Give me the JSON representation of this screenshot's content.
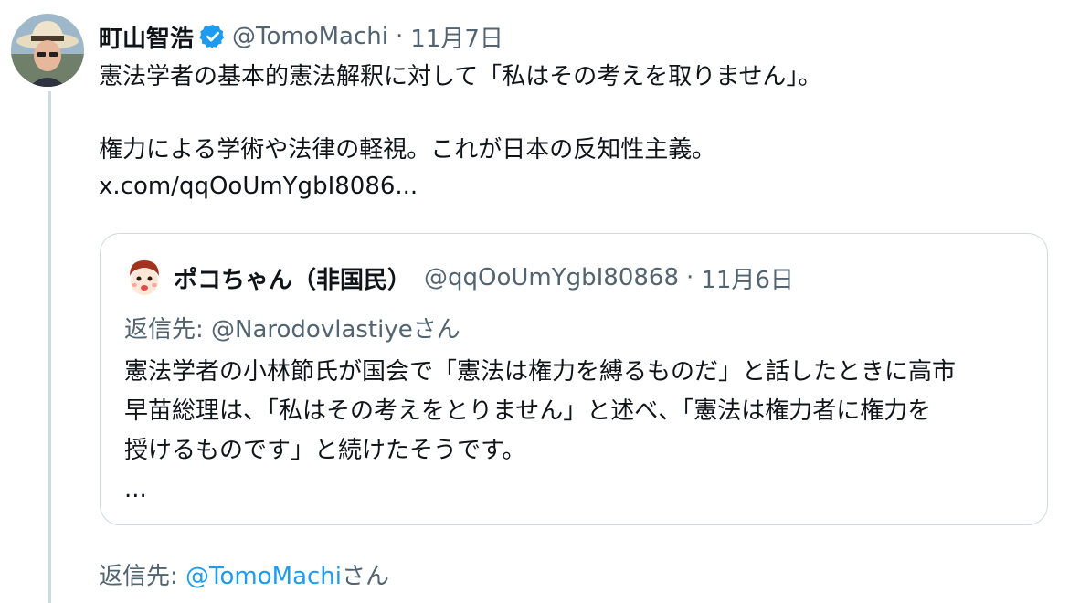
{
  "tweet": {
    "author_name": "町山智浩",
    "author_handle": "@TomoMachi",
    "separator": "·",
    "date": "11月7日",
    "text_line1": "憲法学者の基本的憲法解釈に対して「私はその考えを取りません」。",
    "text_line2": "権力による学術や法律の軽視。これが日本の反知性主義。",
    "link": "x.com/qqOoUmYgbI8086..."
  },
  "quote": {
    "author_name": "ポコちゃん（非国民）",
    "author_handle": "@qqOoUmYgbI80868",
    "separator": "·",
    "date": "11月6日",
    "reply_to": "返信先: @Narodovlastiyeさん",
    "lines": [
      "憲法学者の小林節氏が国会で「憲法は権力を縛るものだ」と話したときに高市",
      "早苗総理は、「私はその考えをとりません」と述べ、「憲法は権力者に権力を",
      "授けるものです」と続けたそうです。",
      "..."
    ]
  },
  "reply": {
    "prefix": "返信先: ",
    "handle": "@TomoMachi",
    "suffix": "さん"
  },
  "colors": {
    "text": "#0f1419",
    "muted": "#536471",
    "link_blue": "#1d9bf0",
    "border": "#cfd9de"
  },
  "icons": {
    "verified": "verified-badge-icon"
  }
}
